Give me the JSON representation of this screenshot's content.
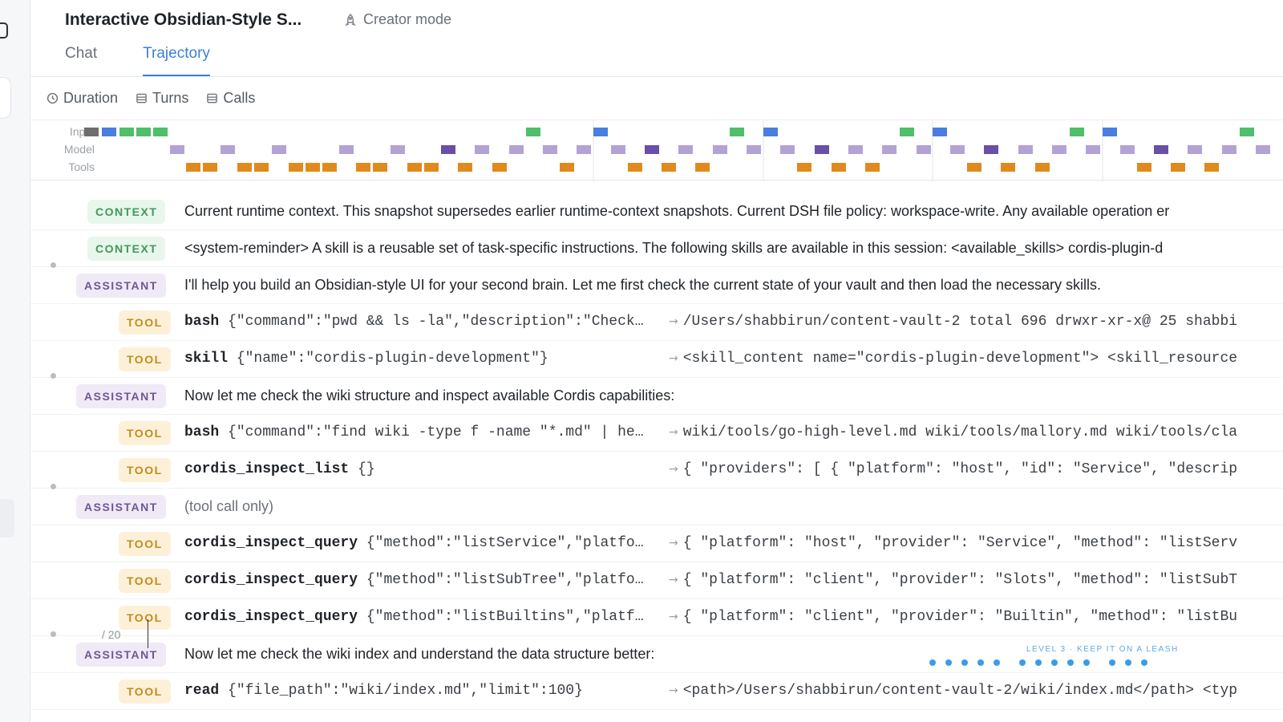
{
  "header": {
    "title": "Interactive Obsidian-Style S...",
    "creator_mode": "Creator mode",
    "tabs": [
      {
        "label": "Chat",
        "active": false
      },
      {
        "label": "Trajectory",
        "active": true
      }
    ]
  },
  "metrics": {
    "duration": "Duration",
    "turns": "Turns",
    "calls": "Calls"
  },
  "timeline": {
    "lanes": [
      "Input",
      "Model",
      "Tools"
    ],
    "colors": {
      "input_gray": "#6e6e6e",
      "input_blue": "#4a7de0",
      "input_green": "#4fbf6a",
      "model_light": "#b3a2d6",
      "model_dark": "#6a4fa8",
      "tools_orange": "#e08a1e"
    }
  },
  "rows": [
    {
      "kind": "CONTEXT",
      "text": "Current runtime context. This snapshot supersedes earlier runtime-context snapshots. Current DSH file policy: workspace-write. Any available operation er"
    },
    {
      "kind": "CONTEXT",
      "text": "<system-reminder> A skill is a reusable set of task-specific instructions. The following skills are available in this session: <available_skills> cordis-plugin-d"
    },
    {
      "kind": "ASSISTANT",
      "text": "I'll help you build an Obsidian-style UI for your second brain. Let me first check the current state of your vault and then load the necessary skills."
    },
    {
      "kind": "TOOL",
      "name": "bash",
      "args": "{\"command\":\"pwd && ls -la\",\"description\":\"Check…",
      "result": "/Users/shabbirun/content-vault-2 total 696 drwxr-xr-x@ 25 shabbi"
    },
    {
      "kind": "TOOL",
      "name": "skill",
      "args": "{\"name\":\"cordis-plugin-development\"}",
      "result": "<skill_content name=\"cordis-plugin-development\"> <skill_resource"
    },
    {
      "kind": "ASSISTANT",
      "text": "Now let me check the wiki structure and inspect available Cordis capabilities:"
    },
    {
      "kind": "TOOL",
      "name": "bash",
      "args": "{\"command\":\"find wiki -type f -name \"*.md\" | he…",
      "result": "wiki/tools/go-high-level.md wiki/tools/mallory.md wiki/tools/cla"
    },
    {
      "kind": "TOOL",
      "name": "cordis_inspect_list",
      "args": "{}",
      "result": "{ \"providers\": [ { \"platform\": \"host\", \"id\": \"Service\", \"descrip"
    },
    {
      "kind": "ASSISTANT",
      "text": "(tool call only)"
    },
    {
      "kind": "TOOL",
      "name": "cordis_inspect_query",
      "args": "{\"method\":\"listService\",\"platfo…",
      "result": "{ \"platform\": \"host\", \"provider\": \"Service\", \"method\": \"listServ"
    },
    {
      "kind": "TOOL",
      "name": "cordis_inspect_query",
      "args": "{\"method\":\"listSubTree\",\"platfo…",
      "result": "{ \"platform\": \"client\", \"provider\": \"Slots\", \"method\": \"listSubT"
    },
    {
      "kind": "TOOL",
      "name": "cordis_inspect_query",
      "args": "{\"method\":\"listBuiltins\",\"platf…",
      "result": "{ \"platform\": \"client\", \"provider\": \"Builtin\", \"method\": \"listBu"
    },
    {
      "kind": "ASSISTANT",
      "text": "Now let me check the wiki index and understand the data structure better:"
    },
    {
      "kind": "TOOL",
      "name": "read",
      "args": "{\"file_path\":\"wiki/index.md\",\"limit\":100}",
      "result": "<path>/Users/shabbirun/content-vault-2/wiki/index.md</path> <typ"
    }
  ],
  "overlay": {
    "pager": "/ 20",
    "level": "LEVEL 3 · KEEP IT ON A LEASH"
  }
}
